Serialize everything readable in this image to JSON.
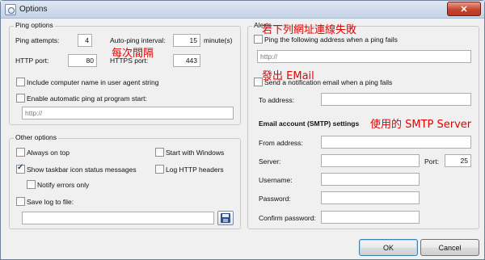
{
  "window": {
    "title": "Options",
    "close_symbol": "✕"
  },
  "ping": {
    "group_title": "Ping options",
    "attempts_label": "Ping attempts:",
    "attempts_value": "4",
    "interval_label": "Auto-ping interval:",
    "interval_value": "15",
    "interval_unit": "minute(s)",
    "http_port_label": "HTTP port:",
    "http_port_value": "80",
    "https_port_label": "HTTPS port:",
    "https_port_value": "443",
    "include_name_label": "Include computer name in user agent string",
    "include_name_checked": false,
    "auto_ping_label": "Enable automatic ping at program start:",
    "auto_ping_checked": false,
    "auto_ping_url_placeholder": "http://"
  },
  "other": {
    "group_title": "Other options",
    "always_on_top_label": "Always on top",
    "always_on_top_checked": false,
    "start_windows_label": "Start with Windows",
    "start_windows_checked": false,
    "taskbar_label": "Show taskbar icon status messages",
    "taskbar_checked": true,
    "log_http_label": "Log HTTP headers",
    "log_http_checked": false,
    "notify_errors_label": "Notify errors only",
    "notify_errors_checked": false,
    "save_log_label": "Save log to file:",
    "save_log_checked": false,
    "save_log_path": ""
  },
  "alerts": {
    "group_title": "Alerts",
    "ping_fail_label": "Ping the following address when a ping fails",
    "ping_fail_checked": false,
    "ping_fail_placeholder": "http://",
    "notify_email_label": "Send a notification email when a ping fails",
    "notify_email_checked": false,
    "to_address_label": "To address:",
    "to_address_value": "",
    "smtp_heading": "Email account (SMTP) settings",
    "from_address_label": "From address:",
    "from_address_value": "",
    "server_label": "Server:",
    "server_value": "",
    "port_label": "Port:",
    "port_value": "25",
    "username_label": "Username:",
    "username_value": "",
    "password_label": "Password:",
    "password_value": "",
    "confirm_password_label": "Confirm password:",
    "confirm_password_value": ""
  },
  "annotations": {
    "interval": "每次間隔",
    "ping_fail": "若下列網址連線失敗",
    "email": "發出 EMail",
    "smtp": "使用的 SMTP Server"
  },
  "buttons": {
    "ok": "OK",
    "cancel": "Cancel"
  },
  "colors": {
    "annotation": "#e60000",
    "close_button": "#c6452f",
    "default_button_border": "#3c7fb1"
  }
}
